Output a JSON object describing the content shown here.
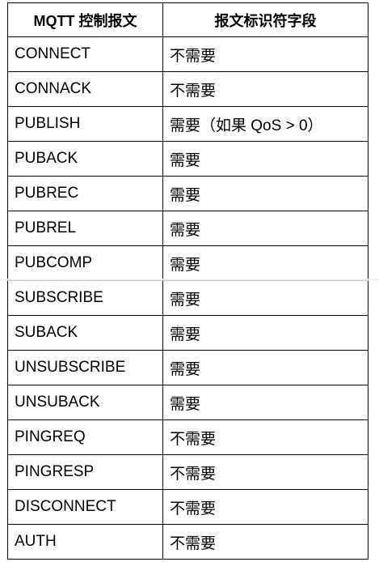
{
  "table": {
    "headers": [
      "MQTT 控制报文",
      "报文标识符字段"
    ],
    "rows": [
      {
        "packet": "CONNECT",
        "identifier": "不需要"
      },
      {
        "packet": "CONNACK",
        "identifier": "不需要"
      },
      {
        "packet": "PUBLISH",
        "identifier": "需要（如果 QoS > 0）"
      },
      {
        "packet": "PUBACK",
        "identifier": "需要"
      },
      {
        "packet": "PUBREC",
        "identifier": "需要"
      },
      {
        "packet": "PUBREL",
        "identifier": "需要"
      },
      {
        "packet": "PUBCOMP",
        "identifier": "需要"
      },
      {
        "packet": "SUBSCRIBE",
        "identifier": "需要"
      },
      {
        "packet": "SUBACK",
        "identifier": "需要"
      },
      {
        "packet": "UNSUBSCRIBE",
        "identifier": "需要"
      },
      {
        "packet": "UNSUBACK",
        "identifier": "需要"
      },
      {
        "packet": "PINGREQ",
        "identifier": "不需要"
      },
      {
        "packet": "PINGRESP",
        "identifier": "不需要"
      },
      {
        "packet": "DISCONNECT",
        "identifier": "不需要"
      },
      {
        "packet": "AUTH",
        "identifier": "不需要"
      }
    ]
  }
}
